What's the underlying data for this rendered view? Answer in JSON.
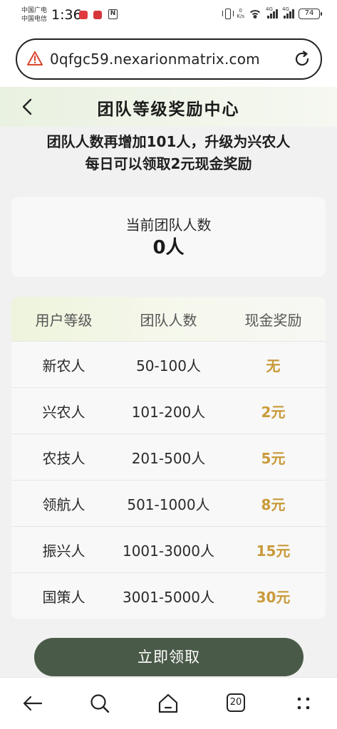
{
  "status_bar": {
    "carrier_1": "中国广电",
    "carrier_2": "中国电信",
    "time": "1:36",
    "net_speed_value": "0",
    "net_speed_unit": "K/s",
    "network_type_1": "4G",
    "network_type_2": "4G",
    "battery": "74"
  },
  "browser": {
    "url": "0qfgc59.nexarionmatrix.com",
    "tab_count": "20"
  },
  "header": {
    "title": "团队等级奖励中心"
  },
  "promo": {
    "line1": "团队人数再增加101人，升级为兴农人",
    "line2": "每日可以领取2元现金奖励"
  },
  "team_count": {
    "label": "当前团队人数",
    "value": "0人"
  },
  "table": {
    "headers": [
      "用户等级",
      "团队人数",
      "现金奖励"
    ],
    "rows": [
      {
        "level": "新农人",
        "members": "50-100人",
        "reward": "无"
      },
      {
        "level": "兴农人",
        "members": "101-200人",
        "reward": "2元"
      },
      {
        "level": "农技人",
        "members": "201-500人",
        "reward": "5元"
      },
      {
        "level": "领航人",
        "members": "501-1000人",
        "reward": "8元"
      },
      {
        "level": "振兴人",
        "members": "1001-3000人",
        "reward": "15元"
      },
      {
        "level": "国策人",
        "members": "3001-5000人",
        "reward": "30元"
      }
    ]
  },
  "claim_button": "立即领取",
  "colors": {
    "accent_gold": "#c99a3a",
    "button_green": "#4a5a48",
    "header_tint": "#e9f1e0"
  },
  "icons": {
    "back": "chevron-left-icon",
    "warning": "warning-triangle-icon",
    "reload": "reload-icon",
    "nav": [
      "arrow-left-icon",
      "search-icon",
      "home-icon",
      "tabs-icon",
      "more-dots-icon"
    ]
  }
}
